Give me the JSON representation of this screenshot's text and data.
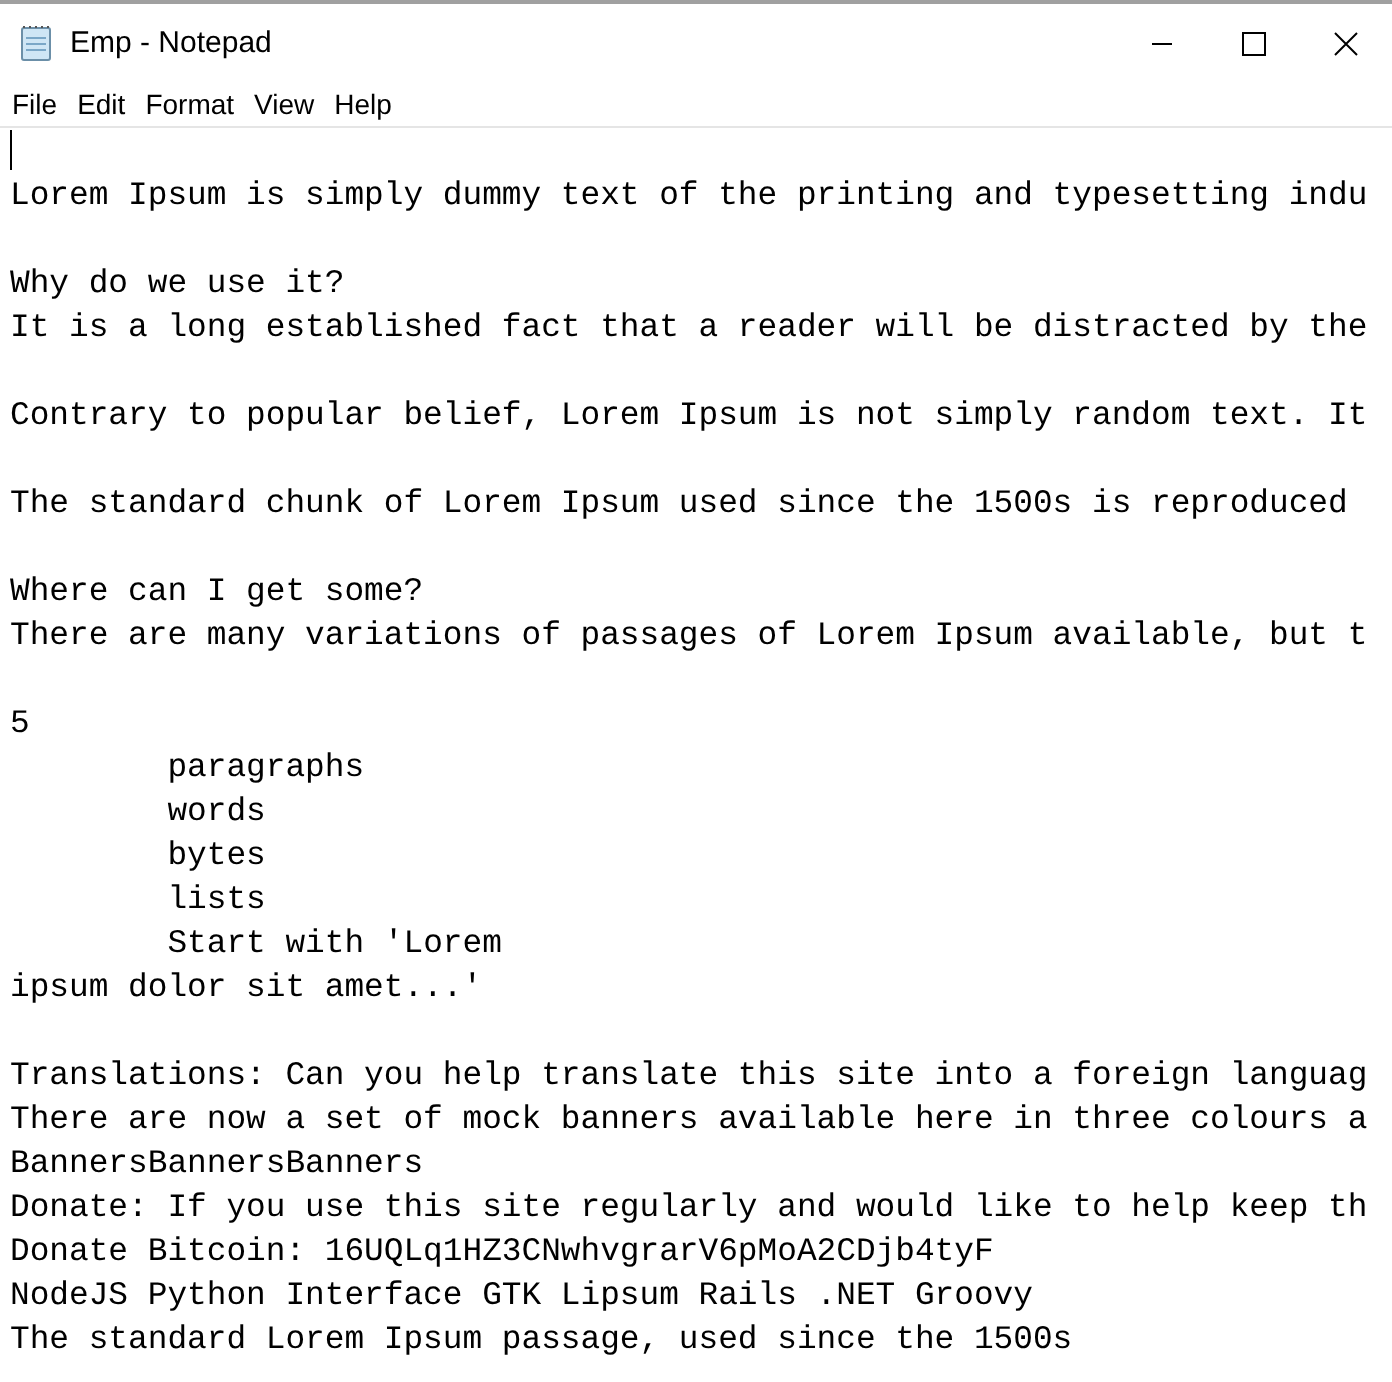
{
  "window": {
    "title": "Emp - Notepad"
  },
  "menu": [
    "File",
    "Edit",
    "Format",
    "View",
    "Help"
  ],
  "editor": {
    "caret": true,
    "blocks": [
      [
        "Lorem Ipsum is simply dummy text of the printing and typesetting indu"
      ],
      [
        "Why do we use it?",
        "It is a long established fact that a reader will be distracted by the"
      ],
      [
        "Contrary to popular belief, Lorem Ipsum is not simply random text. It"
      ],
      [
        "The standard chunk of Lorem Ipsum used since the 1500s is reproduced"
      ],
      [
        "Where can I get some?",
        "There are many variations of passages of Lorem Ipsum available, but t"
      ],
      [
        "5",
        "\tparagraphs",
        "\twords",
        "\tbytes",
        "\tlists",
        "\tStart with 'Lorem",
        "ipsum dolor sit amet...'"
      ],
      [
        "Translations: Can you help translate this site into a foreign languag",
        "There are now a set of mock banners available here in three colours a",
        "BannersBannersBanners",
        "Donate: If you use this site regularly and would like to help keep th",
        "Donate Bitcoin: 16UQLq1HZ3CNwhvgrarV6pMoA2CDjb4tyF",
        "NodeJS Python Interface GTK Lipsum Rails .NET Groovy",
        "The standard Lorem Ipsum passage, used since the 1500s"
      ]
    ]
  }
}
